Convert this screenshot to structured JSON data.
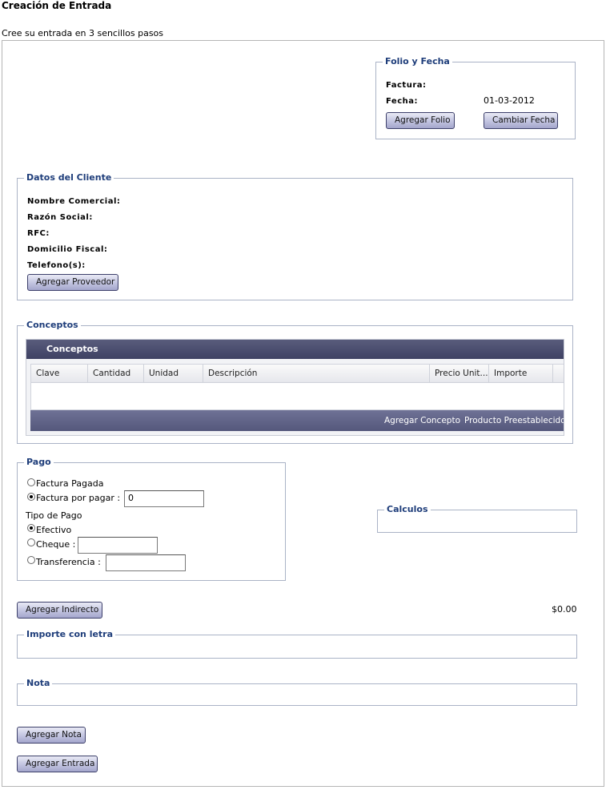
{
  "page": {
    "title": "Creación de Entrada",
    "subtitle": "Cree su entrada en 3 sencillos pasos"
  },
  "folio": {
    "legend": "Folio y Fecha",
    "factura_label": "Factura:",
    "fecha_label": "Fecha:",
    "fecha_value": "01-03-2012",
    "agregar_folio": "Agregar Folio",
    "cambiar_fecha": "Cambiar Fecha"
  },
  "cliente": {
    "legend": "Datos del Cliente",
    "nombre_label": "Nombre Comercial:",
    "razon_label": "Razón Social:",
    "rfc_label": "RFC:",
    "domicilio_label": "Domicilio Fiscal:",
    "telefono_label": "Telefono(s):",
    "agregar_proveedor": "Agregar Proveedor"
  },
  "conceptos": {
    "legend": "Conceptos",
    "grid_title": "Conceptos",
    "columns": [
      "Clave",
      "Cantidad",
      "Unidad",
      "Descripción",
      "Precio Unit...",
      "Importe"
    ],
    "agregar_concepto": "Agregar Concepto",
    "producto_preestablecido": "Producto Preestablecido"
  },
  "pago": {
    "legend": "Pago",
    "factura_pagada": "Factura Pagada",
    "factura_por_pagar": "Factura por pagar :",
    "factura_por_pagar_value": "0",
    "tipo_pago": "Tipo de Pago",
    "efectivo": "Efectivo",
    "cheque": "Cheque :",
    "transferencia": "Transferencia :"
  },
  "calculos": {
    "legend": "Calculos"
  },
  "totales": {
    "agregar_indirecto": "Agregar Indirecto",
    "total": "$0.00"
  },
  "importe_letra": {
    "legend": "Importe con letra"
  },
  "nota": {
    "legend": "Nota",
    "agregar_nota": "Agregar Nota"
  },
  "actions": {
    "agregar_entrada": "Agregar Entrada"
  }
}
